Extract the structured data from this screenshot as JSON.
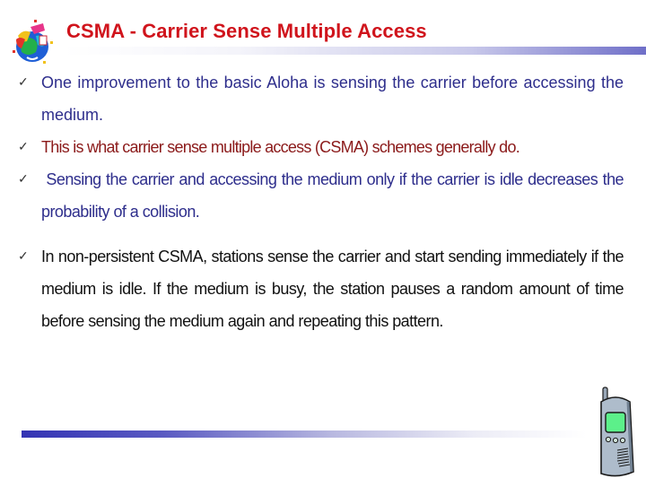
{
  "slide": {
    "title": "CSMA - Carrier Sense Multiple Access",
    "logo_icon": "globe-clipart-icon",
    "bullet_icon": "checkmark-icon",
    "bullets": [
      {
        "text": "One improvement to the basic Aloha is sensing the carrier before accessing the medium.",
        "color": "#2e2e8c"
      },
      {
        "text": "This is what carrier sense multiple access (CSMA) schemes generally do.",
        "color": "#8b1a1a"
      },
      {
        "text": " Sensing the carrier and accessing the medium only if the carrier is idle decreases the probability of a collision.",
        "color": "#2e2e8c"
      },
      {
        "text": "In non-persistent CSMA, stations sense the carrier and start sending immediately if the medium is idle. If the medium is busy, the station pauses a random amount of time before sensing the medium again and repeating this pattern.",
        "color": "#111111"
      }
    ],
    "check_glyph": "✓",
    "decoration_icon": "mobile-phone-icon",
    "colors": {
      "title": "#d0141c",
      "accent_rule": "#3434b4"
    }
  }
}
